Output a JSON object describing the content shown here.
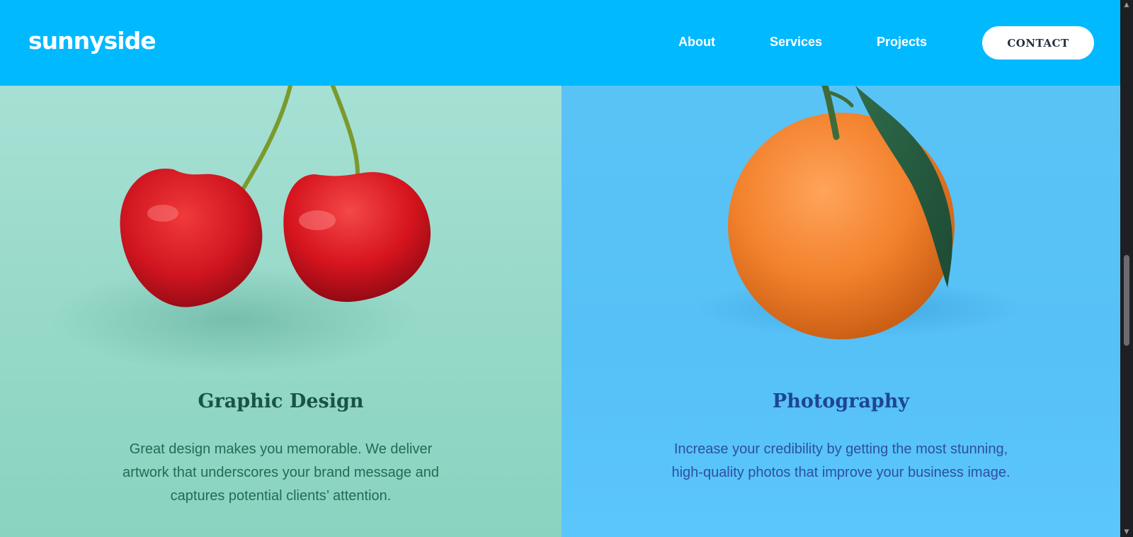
{
  "header": {
    "logo": "sunnyside",
    "nav": [
      "About",
      "Services",
      "Projects"
    ],
    "contact_label": "CONTACT"
  },
  "panels": [
    {
      "title": "Graphic Design",
      "text": "Great design makes you memorable. We deliver artwork that underscores your brand message and captures potential clients’ attention.",
      "image": "cherries-image"
    },
    {
      "title": "Photography",
      "text": "Increase your credibility by getting the most stunning, high-quality photos that improve your business image.",
      "image": "orange-image"
    }
  ],
  "colors": {
    "header_bg": "#00b9ff",
    "graphic_bg": "#a6e0d4",
    "photo_bg": "#5ac3f5",
    "graphic_text": "#19534a",
    "photo_text": "#1e4595"
  },
  "scrollbar": {
    "up_icon": "scroll-up-icon",
    "down_icon": "scroll-down-icon"
  }
}
